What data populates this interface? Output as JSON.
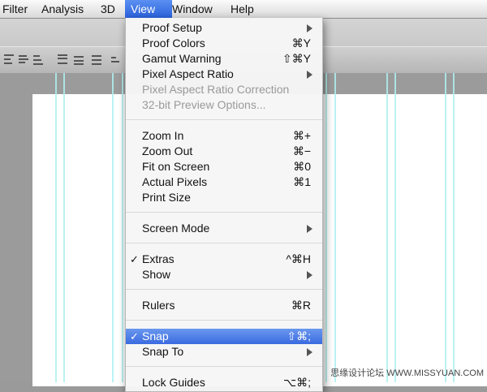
{
  "menubar": {
    "items": [
      "Filter",
      "Analysis",
      "3D",
      "View",
      "Window",
      "Help"
    ],
    "active": "View"
  },
  "view_menu": {
    "proof_setup": {
      "label": "Proof Setup"
    },
    "proof_colors": {
      "label": "Proof Colors",
      "shortcut": "⌘Y"
    },
    "gamut_warning": {
      "label": "Gamut Warning",
      "shortcut": "⇧⌘Y"
    },
    "pixel_aspect_ratio": {
      "label": "Pixel Aspect Ratio"
    },
    "pixel_aspect_ratio_correction": {
      "label": "Pixel Aspect Ratio Correction"
    },
    "preview_options": {
      "label": "32-bit Preview Options..."
    },
    "zoom_in": {
      "label": "Zoom In",
      "shortcut": "⌘+"
    },
    "zoom_out": {
      "label": "Zoom Out",
      "shortcut": "⌘−"
    },
    "fit_on_screen": {
      "label": "Fit on Screen",
      "shortcut": "⌘0"
    },
    "actual_pixels": {
      "label": "Actual Pixels",
      "shortcut": "⌘1"
    },
    "print_size": {
      "label": "Print Size"
    },
    "screen_mode": {
      "label": "Screen Mode"
    },
    "extras": {
      "label": "Extras",
      "shortcut": "^⌘H",
      "check": "✓"
    },
    "show": {
      "label": "Show"
    },
    "rulers": {
      "label": "Rulers",
      "shortcut": "⌘R"
    },
    "snap": {
      "label": "Snap",
      "shortcut": "⇧⌘;",
      "check": "✓"
    },
    "snap_to": {
      "label": "Snap To"
    },
    "lock_guides": {
      "label": "Lock Guides",
      "shortcut": "⌥⌘;"
    }
  },
  "watermark": "思缘设计论坛 WWW.MISSYUAN.COM",
  "colors": {
    "highlight": "#3a6be0",
    "guide": "#aef0f0"
  }
}
